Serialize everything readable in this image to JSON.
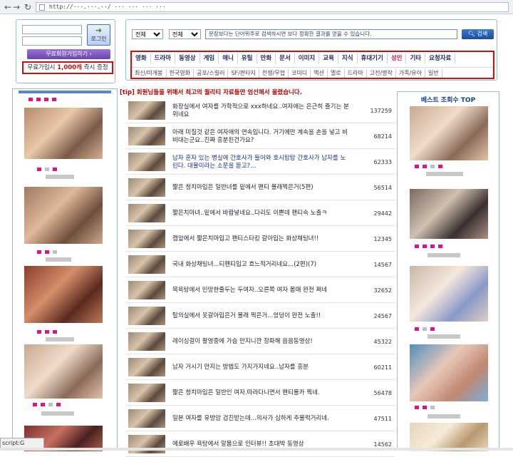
{
  "browser": {
    "url": "http://···.···.··/ ··· ··· ··· ···",
    "status_text": "script:G"
  },
  "login": {
    "button_label": "로그인",
    "join_label": "무료회원가입하기 ›",
    "promo_prefix": "무료가입시 ",
    "promo_amount": "1,000",
    "promo_unit": "캐",
    "promo_suffix": " 즉시 증정"
  },
  "search": {
    "select1": "전체",
    "select2": "전체",
    "hint": "문장보다는 단어위주로 검색하시면 보다 정확한 결과를 얻을 수 있습니다.",
    "button_label": "검색"
  },
  "categories": {
    "main": [
      "영화",
      "드라마",
      "동영상",
      "게임",
      "애니",
      "유틸",
      "만화",
      "문서",
      "이미지",
      "교육",
      "지식",
      "휴대기기",
      "성인",
      "기타",
      "요청자료"
    ],
    "sub": [
      "최신/미개봉",
      "한국영화",
      "공포/스릴러",
      "SF/판타지",
      "전쟁/무협",
      "코미디",
      "액션",
      "멜로",
      "드라마",
      "고전/명작",
      "가족/유아",
      "일반"
    ]
  },
  "tip": "[tip] 회원님들을 위해서 최고의 퀄리티 자료들만 엄선해서 올렸습니다.",
  "right_title": "베스트 조회수 TOP",
  "posts": [
    {
      "title": "화장실에서 여자를 가학적으로 xxx하네요..여자애는 은근히 즐기는 분위네요",
      "count": "137259",
      "link": false
    },
    {
      "title": "아래 미칠것 같은 여자애의 연속입니다. 거기에만 계속을 손을 넣고 비비대는군요..진짜 흥분된건가요?",
      "count": "68214",
      "link": false
    },
    {
      "title": "남자 혼자 있는 병실에 간호사가 들어와 호시탐탐 간호사가 남자를 노린다. 대물이라는 소문을 듣고?...",
      "count": "62333",
      "link": true
    },
    {
      "title": "짧은 청치마입은 일반녀를 밑에서 팬티 몰래찍은거(5편)",
      "count": "56514",
      "link": false
    },
    {
      "title": "짧은치마녀..밑에서 바람넣네요..다리도 이쁜데 팬티속 노출ㅋ",
      "count": "29442",
      "link": false
    },
    {
      "title": "캠앞에서 짧은치마입고 팬티스타킹 갈아입는 화상채팅녀!!",
      "count": "12345",
      "link": false
    },
    {
      "title": "국내 화상채팅녀...티팬티입고 흐느적거리네요...(2편)(7)",
      "count": "14567",
      "link": false
    },
    {
      "title": "목욕탕에서 민망한줄두는 두여자..오른쪽 여자 몸매 완전 쩌네",
      "count": "32652",
      "link": false
    },
    {
      "title": "탈의실에서 옷갈아입은거 몰래 찍은거...엉덩이 완전 노출!!",
      "count": "24567",
      "link": false
    },
    {
      "title": "레이싱걸이 촬영중에 가슴 만지니깐 장파해 음음동영상!",
      "count": "45322",
      "link": false
    },
    {
      "title": "남자 거시기 만지는 방법도 가지가지네요..남자를 흥분",
      "count": "60211",
      "link": false
    },
    {
      "title": "짧은 청치마입은 일반인 여자.따라다니면서 팬티몰카 찍네.",
      "count": "56478",
      "link": false
    },
    {
      "title": "일본 여자를 유방암 검진받는데...의사가 심하게 주물럭거리네.",
      "count": "47511",
      "link": false
    },
    {
      "title": "에로배우 욕탕에서 알몸으로 인터뷰!! 초대박 동영상",
      "count": "14562",
      "link": false
    }
  ],
  "colors": {
    "accent_red": "#d01010",
    "link_blue": "#1a2f8f",
    "panel_border": "#9fb8d3",
    "dot_pink": "#e0118a"
  },
  "icons": [
    "back-icon",
    "forward-icon",
    "refresh-icon",
    "page-icon",
    "login-icon",
    "search-icon"
  ]
}
